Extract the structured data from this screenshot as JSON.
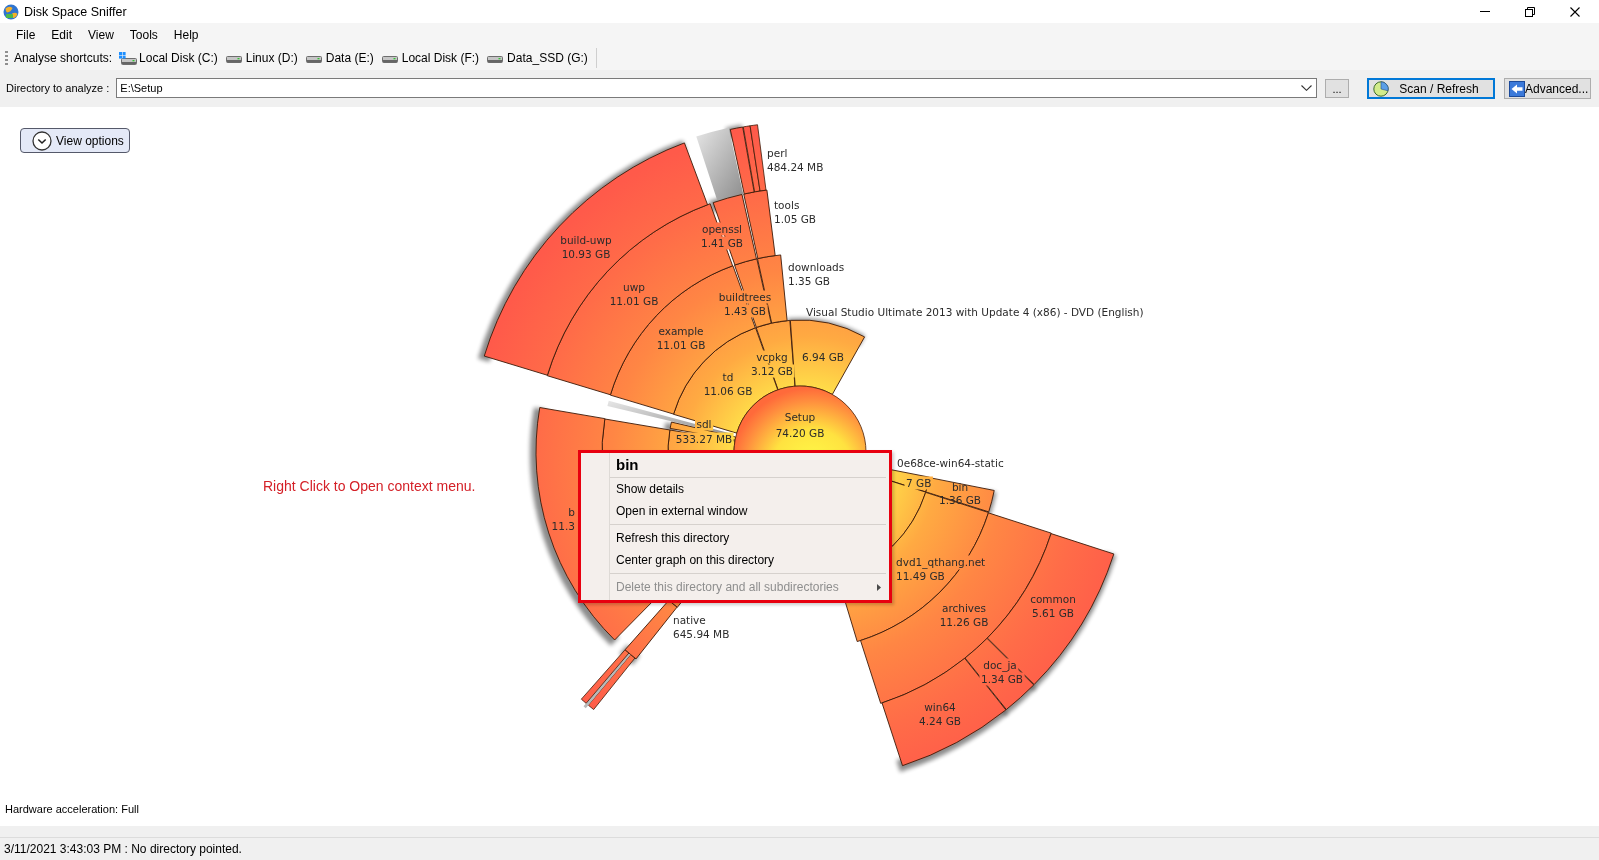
{
  "window": {
    "title": "Disk Space Sniffer"
  },
  "menu_bar": [
    "File",
    "Edit",
    "View",
    "Tools",
    "Help"
  ],
  "shortcuts": {
    "label": "Analyse shortcuts:",
    "drives": [
      {
        "label": "Local Disk (C:)",
        "kind": "system"
      },
      {
        "label": "Linux (D:)",
        "kind": "disk"
      },
      {
        "label": "Data (E:)",
        "kind": "disk"
      },
      {
        "label": "Local Disk (F:)",
        "kind": "disk"
      },
      {
        "label": "Data_SSD (G:)",
        "kind": "disk"
      }
    ]
  },
  "directory": {
    "label": "Directory to analyze :",
    "value": "E:\\Setup",
    "browse_button": "...",
    "buttons": [
      {
        "label": "Scan / Refresh",
        "kind": "scan",
        "default": true
      },
      {
        "label": "Advanced...",
        "kind": "advanced",
        "default": false
      }
    ]
  },
  "view_options": {
    "label": "View options"
  },
  "chart": {
    "root": {
      "name": "Setup",
      "size": "74.20 GB",
      "children": [
        {
          "name": "vcpkg",
          "size": "3.12 GB",
          "children": [
            {
              "name": "downloads",
              "size": "1.35 GB",
              "children": [
                {
                  "name": "tools",
                  "size": "1.05 GB",
                  "children": [
                    {
                      "name": "perl",
                      "size": "484.24 MB"
                    }
                  ]
                }
              ]
            },
            {
              "name": "buildtrees",
              "size": "1.43 GB",
              "children": [
                {
                  "name": "openssl",
                  "size": "1.41 GB"
                }
              ]
            }
          ]
        },
        {
          "name": "td",
          "size": "11.06 GB",
          "children": [
            {
              "name": "example",
              "size": "11.01 GB",
              "children": [
                {
                  "name": "uwp",
                  "size": "11.01 GB",
                  "children": [
                    {
                      "name": "build-uwp",
                      "size": "10.93 GB"
                    }
                  ]
                }
              ]
            }
          ]
        },
        {
          "name": "Visual Studio Ultimate 2013 with Update 4 (x86) - DVD (English)",
          "size": "6.94 GB"
        },
        {
          "name": "sdl",
          "size": "533.27 MB"
        },
        {
          "name": "0e68ce-win64-static",
          "size": "7 GB",
          "children": [
            {
              "name": "bin",
              "size": "1.36 GB"
            }
          ]
        },
        {
          "children": [
            {
              "children": [
                {
                  "name": "b",
                  "size": "11.3"
                }
              ]
            }
          ]
        },
        {
          "children": [
            {
              "name": "dvd1_qthang.net",
              "size": "11.49 GB",
              "children": [
                {
                  "name": "archives",
                  "size": "11.26 GB",
                  "children": [
                    {
                      "name": "common",
                      "size": "5.61 GB"
                    },
                    {
                      "name": "doc_ja",
                      "size": "1.34 GB"
                    },
                    {
                      "name": "win64",
                      "size": "4.24 GB"
                    }
                  ]
                }
              ]
            }
          ]
        },
        {
          "children": [
            {
              "children": [
                {
                  "name": "native",
                  "size": "645.94 MB"
                }
              ]
            }
          ]
        }
      ]
    }
  },
  "annotation": "Right Click to Open context menu.",
  "context_menu": {
    "title": "bin",
    "items": [
      {
        "kind": "item",
        "label": "Show details",
        "disabled": false,
        "submenu": false
      },
      {
        "kind": "item",
        "label": "Open in external window",
        "disabled": false,
        "submenu": false
      },
      {
        "kind": "separator"
      },
      {
        "kind": "item",
        "label": "Refresh this directory",
        "disabled": false,
        "submenu": false
      },
      {
        "kind": "item",
        "label": "Center graph on this directory",
        "disabled": false,
        "submenu": false
      },
      {
        "kind": "separator"
      },
      {
        "kind": "item",
        "label": "Delete this directory and all subdirectories",
        "disabled": true,
        "submenu": true
      }
    ]
  },
  "hardware_acceleration": "Hardware acceleration: Full",
  "status_bar": "3/11/2021 3:43:03 PM : No directory pointed."
}
